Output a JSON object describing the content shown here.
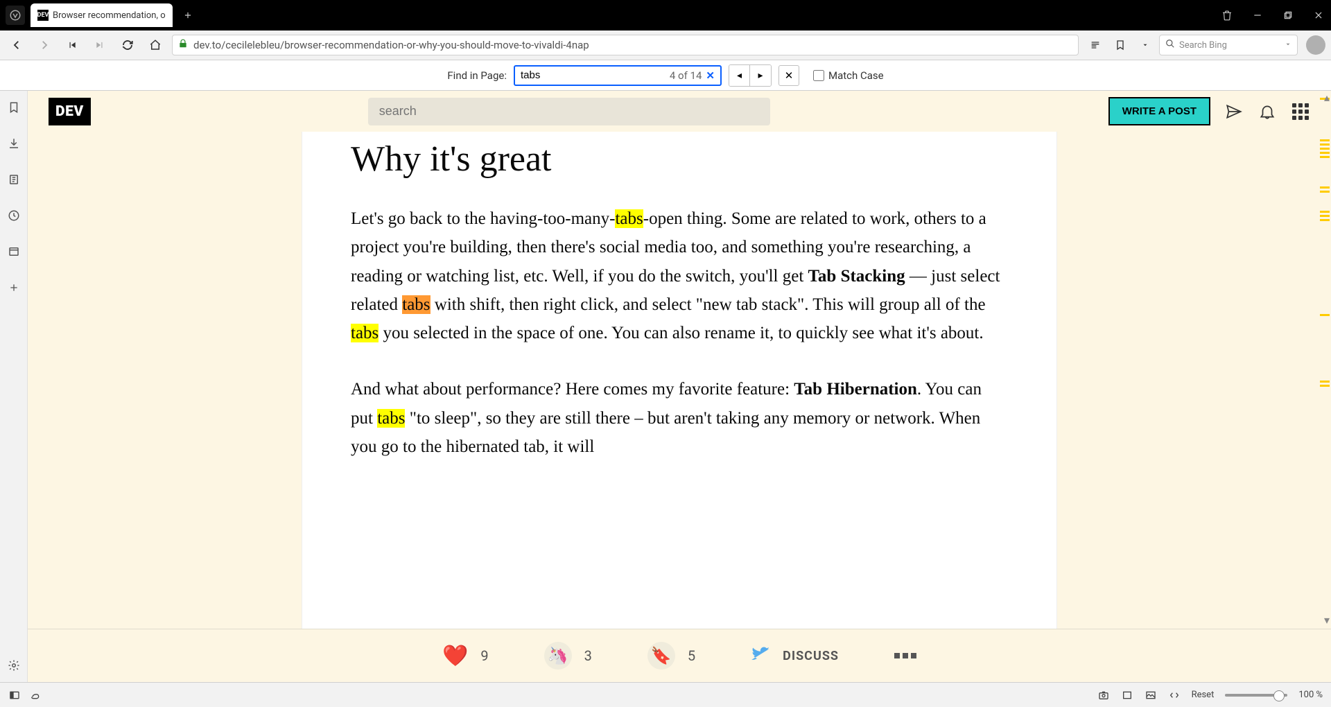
{
  "tab": {
    "title": "Browser recommendation, o",
    "favicon_text": "DEV"
  },
  "url": "dev.to/cecilelebleu/browser-recommendation-or-why-you-should-move-to-vivaldi-4nap",
  "search_placeholder": "Search Bing",
  "find": {
    "label": "Find in Page:",
    "value": "tabs",
    "count": "4 of 14",
    "match_case_label": "Match Case"
  },
  "dev": {
    "logo": "DEV",
    "search_placeholder": "search",
    "write_post": "WRITE A POST"
  },
  "article": {
    "heading": "Why it's great",
    "p1_a": "Let's go back to the having-too-many-",
    "p1_hl1": "tabs",
    "p1_b": "-open thing. Some are related to work, others to a project you're building, then there's social media too, and something you're researching, a reading or watching list, etc. Well, if you do the switch, you'll get ",
    "p1_strong1": "Tab Stacking",
    "p1_c": " — just select related ",
    "p1_hl2": "tabs",
    "p1_d": " with shift, then right click, and select \"new tab stack\". This will group all of the ",
    "p1_hl3": "tabs",
    "p1_e": " you selected in the space of one. You can also rename it, to quickly see what it's about.",
    "p2_a": "And what about performance? Here comes my favorite feature: ",
    "p2_strong1": "Tab Hibernation",
    "p2_b": ". You can put ",
    "p2_hl1": "tabs",
    "p2_c": " \"to sleep\", so they are still there – but aren't taking any memory or network. When you go to the hibernated tab, it will"
  },
  "reactions": {
    "heart": "9",
    "unicorn": "3",
    "bookmark": "5",
    "discuss": "DISCUSS"
  },
  "status": {
    "reset": "Reset",
    "zoom": "100 %"
  }
}
